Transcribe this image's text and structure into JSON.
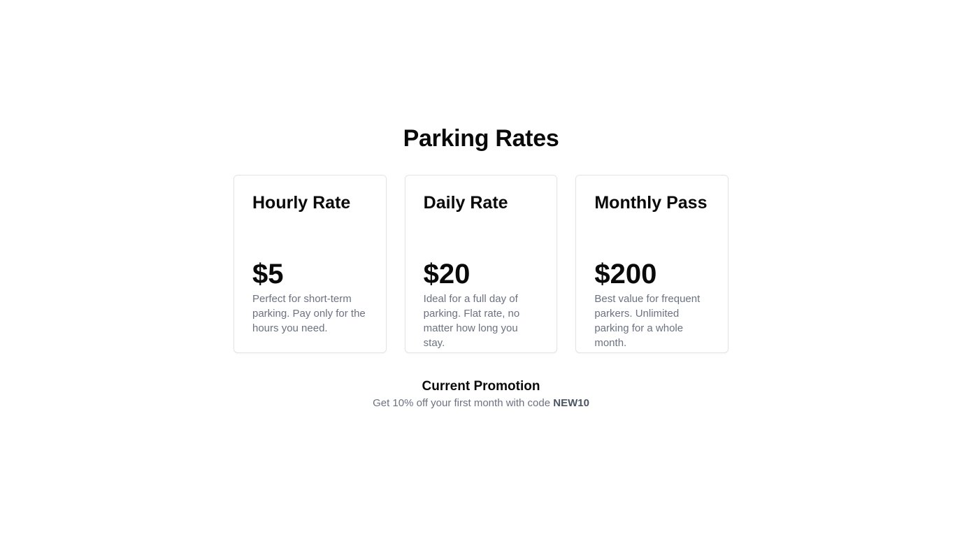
{
  "page": {
    "title": "Parking Rates"
  },
  "cards": [
    {
      "title": "Hourly Rate",
      "price": "$5",
      "description": "Perfect for short-term parking. Pay only for the hours you need."
    },
    {
      "title": "Daily Rate",
      "price": "$20",
      "description": "Ideal for a full day of parking. Flat rate, no matter how long you stay."
    },
    {
      "title": "Monthly Pass",
      "price": "$200",
      "description": "Best value for frequent parkers. Unlimited parking for a whole month."
    }
  ],
  "promotion": {
    "title": "Current Promotion",
    "text": "Get 10% off your first month with code",
    "code": "NEW10"
  },
  "colors": {
    "heading": "#0a0a0a",
    "muted_text": "#6b7280",
    "card_border": "#e2e4e8",
    "background": "#ffffff"
  }
}
